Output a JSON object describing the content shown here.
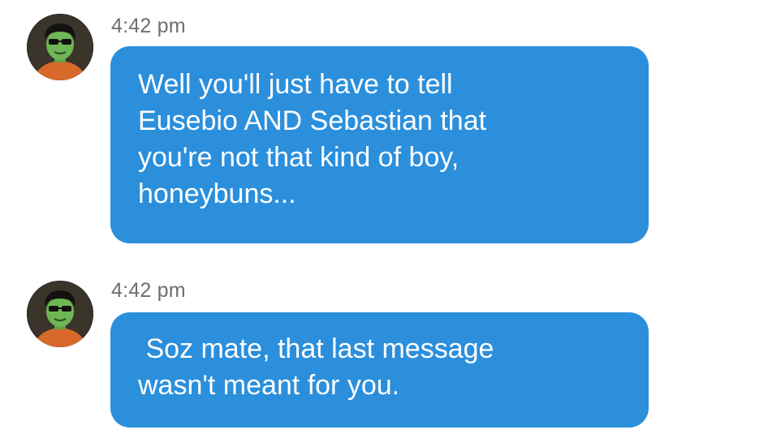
{
  "messages": [
    {
      "timestamp": "4:42 pm",
      "avatar_icon": "character-avatar-icon",
      "lines": [
        "Well you'll just have to tell",
        "Eusebio AND Sebastian that",
        "you're not that kind of boy,",
        "honeybuns..."
      ]
    },
    {
      "timestamp": "4:42 pm",
      "avatar_icon": "character-avatar-icon",
      "lines": [
        " Soz mate, that last message",
        "wasn't meant for you."
      ]
    }
  ],
  "colors": {
    "bubble": "#2b8fdc",
    "bubble_text": "#ffffff",
    "timestamp": "#6e6e6e",
    "background": "#ffffff"
  }
}
